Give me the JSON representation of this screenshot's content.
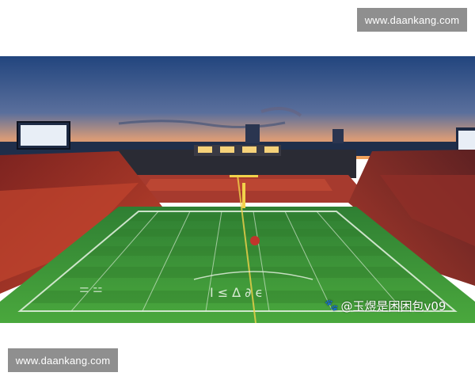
{
  "watermark": {
    "top": "www.daankang.com",
    "bottom": "www.daankang.com"
  },
  "photo": {
    "caption": "@玉煜是困困包v09",
    "caption_icon": "paw-icon",
    "colors": {
      "sky_top": "#22457e",
      "sky_bottom": "#f0a25a",
      "field": "#3f9a3a",
      "stands": "#b3382b"
    }
  }
}
